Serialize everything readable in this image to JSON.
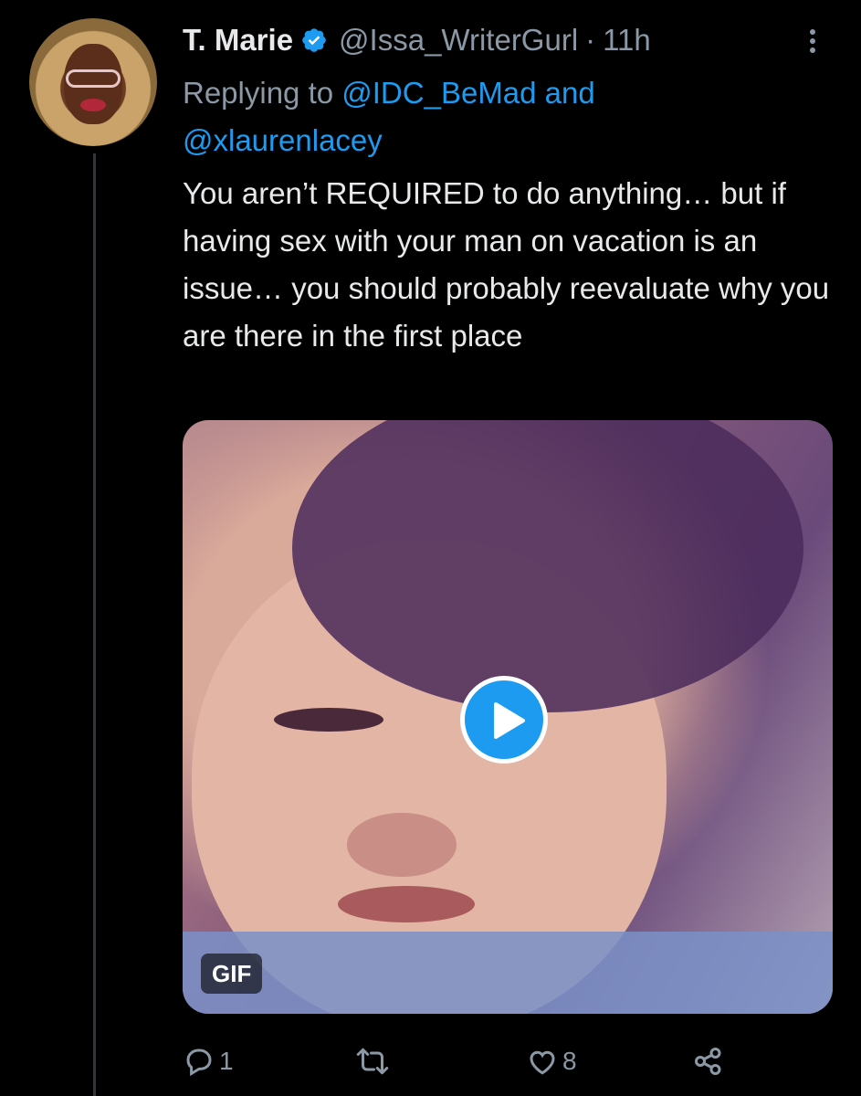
{
  "tweet": {
    "author": {
      "name": "T. Marie",
      "handle": "@Issa_WriterGurl",
      "verified_icon": "verified-badge-icon",
      "time_separator": "·",
      "time": "11h"
    },
    "replying": {
      "prefix": "Replying to ",
      "mention1": "@IDC_BeMad",
      "connector": " and",
      "mention2": "@xlaurenlacey"
    },
    "text": "You aren’t REQUIRED to do anything… but if having sex with your man on vacation is an issue… you should probably reevaluate why you are there in the first place",
    "media": {
      "badge": "GIF",
      "play_icon": "play-icon"
    },
    "actions": {
      "reply_count": "1",
      "retweet_count": "",
      "like_count": "8"
    }
  },
  "colors": {
    "background": "#000000",
    "text": "#e7e9ea",
    "secondary": "#8b98a5",
    "accent": "#1d9bf0"
  }
}
